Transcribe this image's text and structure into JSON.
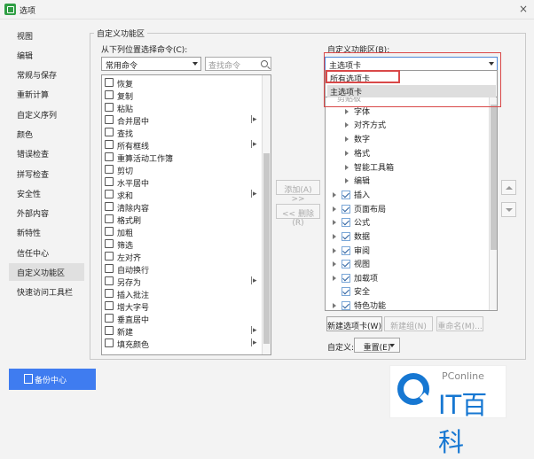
{
  "window": {
    "title": "选项",
    "close_glyph": "×"
  },
  "sidebar": {
    "items": [
      "视图",
      "编辑",
      "常规与保存",
      "重新计算",
      "自定义序列",
      "颜色",
      "错误检查",
      "拼写检查",
      "安全性",
      "外部内容",
      "新特性",
      "信任中心",
      "自定义功能区",
      "快速访问工具栏"
    ],
    "active": "自定义功能区"
  },
  "panel": {
    "group_title": "自定义功能区",
    "left_label": "从下列位置选择命令(C):",
    "left_combo": "常用命令",
    "search_placeholder": "查找命令",
    "right_label": "自定义功能区(B):",
    "right_combo": "主选项卡"
  },
  "commands": [
    {
      "label": "恢复",
      "icon": "undo-icon"
    },
    {
      "label": "复制",
      "icon": "copy-icon"
    },
    {
      "label": "粘贴",
      "icon": "paste-icon"
    },
    {
      "label": "合并居中",
      "icon": "merge-icon",
      "submenu": "|▸"
    },
    {
      "label": "查找",
      "icon": "find-icon"
    },
    {
      "label": "所有框线",
      "icon": "borders-icon",
      "submenu": "|▸"
    },
    {
      "label": "重算活动工作簿",
      "icon": "recalc-icon"
    },
    {
      "label": "剪切",
      "icon": "cut-icon"
    },
    {
      "label": "水平居中",
      "icon": "align-icon"
    },
    {
      "label": "求和",
      "icon": "sum-icon",
      "submenu": "|▸"
    },
    {
      "label": "清除内容",
      "icon": "clear-icon"
    },
    {
      "label": "格式刷",
      "icon": "brush-icon"
    },
    {
      "label": "加粗",
      "icon": "bold-icon"
    },
    {
      "label": "筛选",
      "icon": "filter-icon"
    },
    {
      "label": "左对齐",
      "icon": "left-align-icon"
    },
    {
      "label": "自动换行",
      "icon": "wrap-icon"
    },
    {
      "label": "另存为",
      "icon": "save-as-icon",
      "submenu": "|▸"
    },
    {
      "label": "插入批注",
      "icon": "comment-icon"
    },
    {
      "label": "增大字号",
      "icon": "font-size-icon"
    },
    {
      "label": "垂直居中",
      "icon": "vertical-align-icon"
    },
    {
      "label": "新建",
      "icon": "new-icon",
      "submenu": "|▸"
    },
    {
      "label": "填充颜色",
      "icon": "fill-color-icon",
      "submenu": "|▸"
    }
  ],
  "buttons": {
    "add": "添加(A) >>",
    "remove": "<< 删除(R)",
    "new_tab": "新建选项卡(W)",
    "new_group": "新建组(N)",
    "rename": "重命名(M)...",
    "customize": "自定义:",
    "reset": "重置(E)"
  },
  "dropdown": {
    "options": [
      "所有选项卡",
      "主选项卡"
    ],
    "selected": "主选项卡"
  },
  "tree": {
    "partial_item": "剪贴板",
    "subgroups": [
      "字体",
      "对齐方式",
      "数字",
      "格式",
      "智能工具箱",
      "编辑"
    ],
    "tabs": [
      "插入",
      "页面布局",
      "公式",
      "数据",
      "审阅",
      "视图",
      "加载项",
      "安全",
      "特色功能"
    ]
  },
  "footer": {
    "backup": "备份中心"
  },
  "watermark": {
    "small": "PConline",
    "big": "IT百科"
  },
  "colors": {
    "accent": "#3f7cf0",
    "highlight": "#d94848",
    "watermark": "#1677d2"
  }
}
